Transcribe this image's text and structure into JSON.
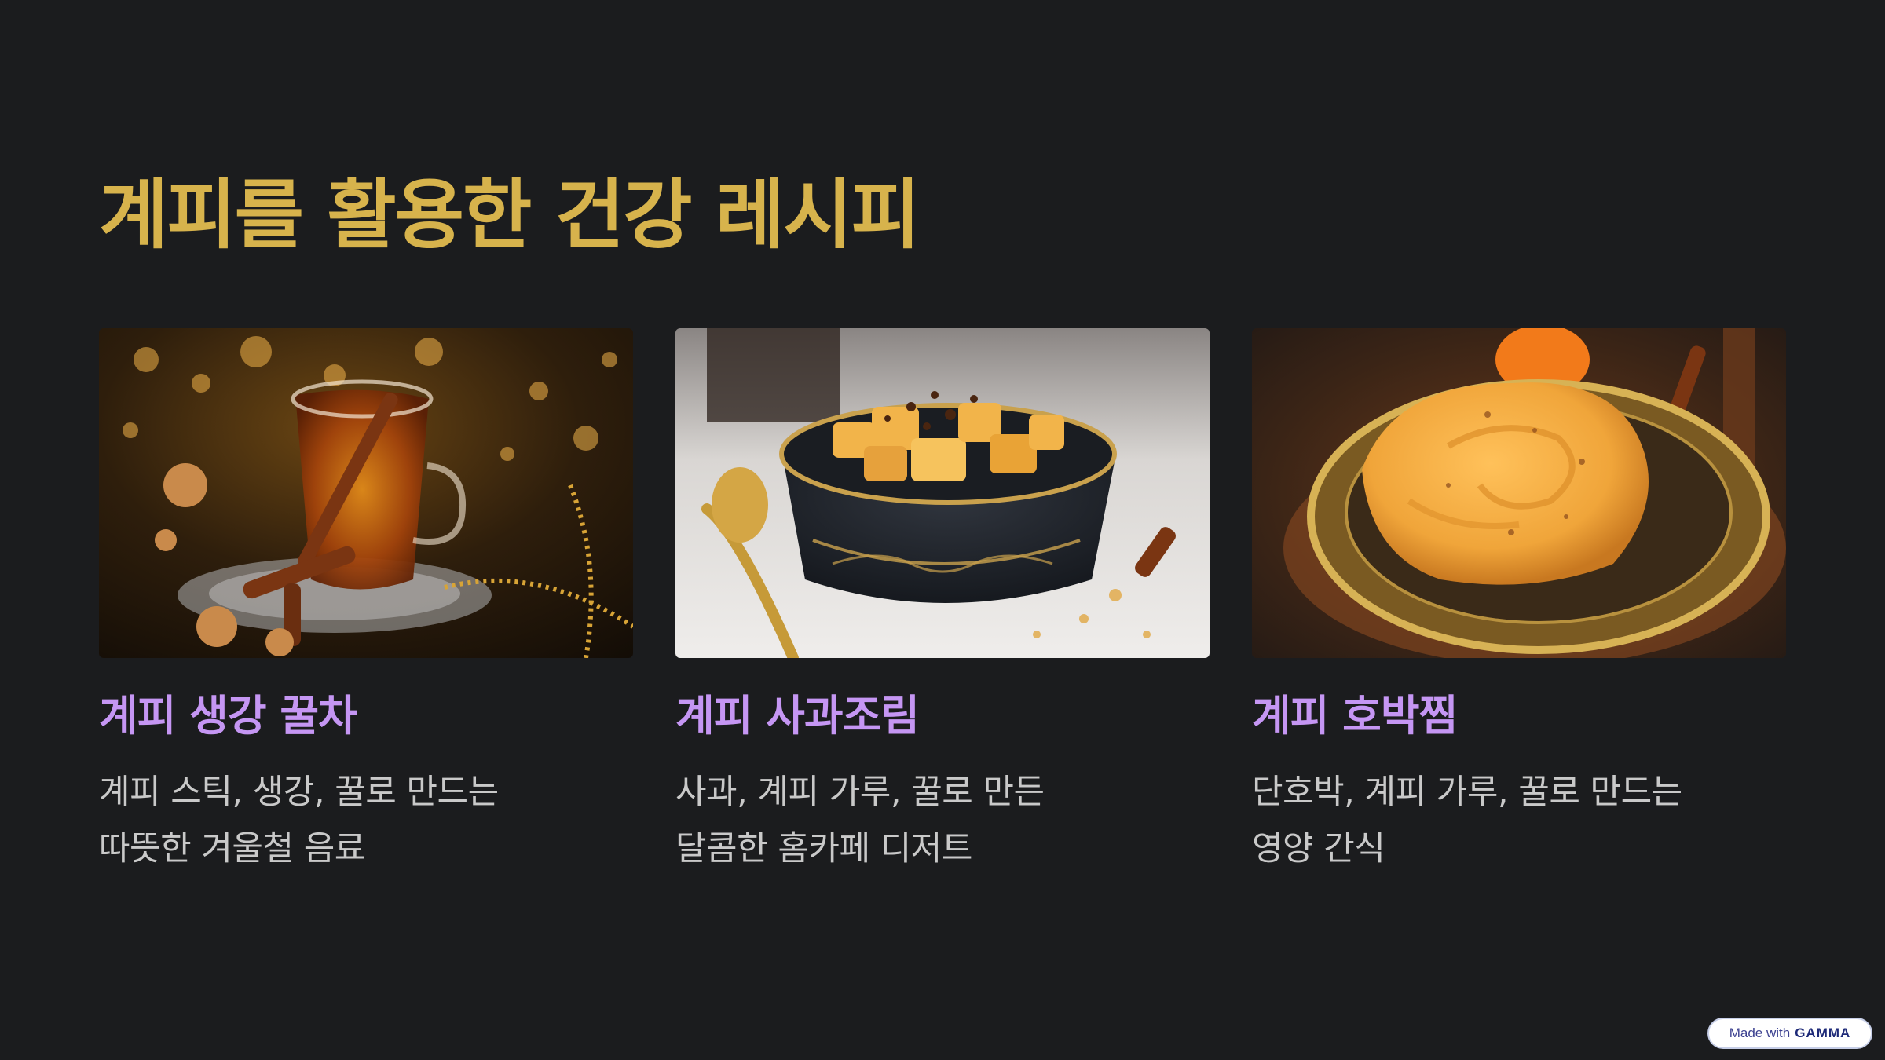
{
  "slide": {
    "title": "계피를 활용한 건강 레시피"
  },
  "cards": [
    {
      "image": "cinnamon-ginger-honey-tea-photo",
      "title": "계피 생강 꿀차",
      "desc_line1": "계피 스틱, 생강, 꿀로 만드는",
      "desc_line2": "따뜻한 겨울철 음료"
    },
    {
      "image": "cinnamon-apple-compote-photo",
      "title": "계피 사과조림",
      "desc_line1": "사과, 계피 가루, 꿀로 만든",
      "desc_line2": "달콤한 홈카페 디저트"
    },
    {
      "image": "cinnamon-steamed-pumpkin-photo",
      "title": "계피 호박찜",
      "desc_line1": "단호박, 계피 가루, 꿀로 만드는",
      "desc_line2": "영양 간식"
    }
  ],
  "badge": {
    "prefix": "Made with",
    "brand": "GAMMA"
  },
  "colors": {
    "background": "#1b1c1e",
    "title": "#d7b34c",
    "card_title": "#c596f3",
    "card_text": "#c9c9c9"
  }
}
